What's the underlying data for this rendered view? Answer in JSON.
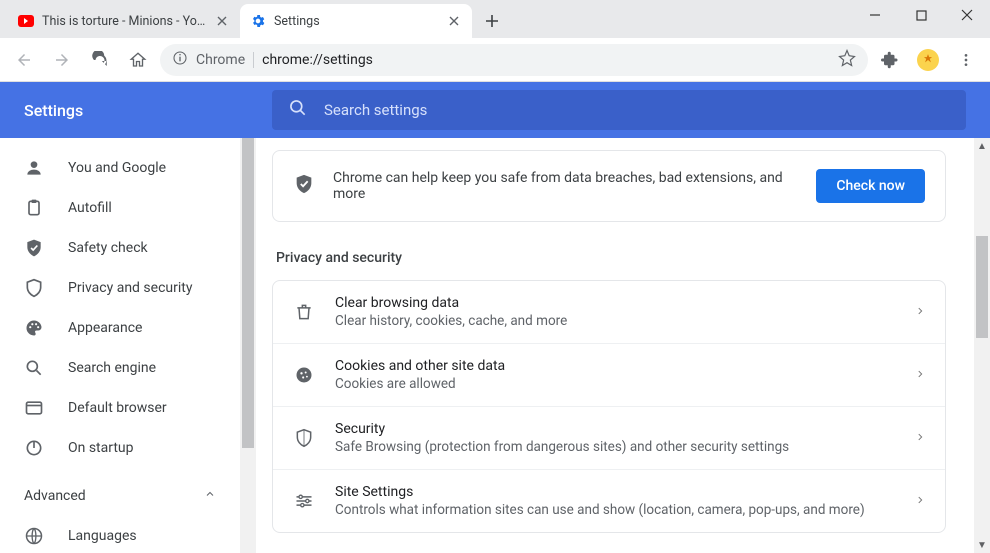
{
  "window": {
    "minimize": "–",
    "maximize": "□",
    "close": "✕"
  },
  "tabs": [
    {
      "title": "This is torture - Minions - YouTube",
      "favicon": "youtube"
    },
    {
      "title": "Settings",
      "favicon": "gear"
    }
  ],
  "toolbar": {
    "chip": "Chrome",
    "url": "chrome://settings"
  },
  "header": {
    "title": "Settings",
    "search_placeholder": "Search settings"
  },
  "sidebar": {
    "items": [
      {
        "icon": "person",
        "label": "You and Google"
      },
      {
        "icon": "clipboard",
        "label": "Autofill"
      },
      {
        "icon": "shield-check",
        "label": "Safety check"
      },
      {
        "icon": "shield",
        "label": "Privacy and security"
      },
      {
        "icon": "palette",
        "label": "Appearance"
      },
      {
        "icon": "search",
        "label": "Search engine"
      },
      {
        "icon": "browser",
        "label": "Default browser"
      },
      {
        "icon": "power",
        "label": "On startup"
      }
    ],
    "advanced": "Advanced",
    "sub_items": [
      {
        "icon": "globe",
        "label": "Languages"
      }
    ]
  },
  "safety_banner": {
    "msg": "Chrome can help keep you safe from data breaches, bad extensions, and more",
    "button": "Check now"
  },
  "section_title": "Privacy and security",
  "rows": [
    {
      "icon": "trash",
      "title": "Clear browsing data",
      "sub": "Clear history, cookies, cache, and more"
    },
    {
      "icon": "cookie",
      "title": "Cookies and other site data",
      "sub": "Cookies are allowed"
    },
    {
      "icon": "shield",
      "title": "Security",
      "sub": "Safe Browsing (protection from dangerous sites) and other security settings"
    },
    {
      "icon": "sliders",
      "title": "Site Settings",
      "sub": "Controls what information sites can use and show (location, camera, pop-ups, and more)"
    }
  ]
}
